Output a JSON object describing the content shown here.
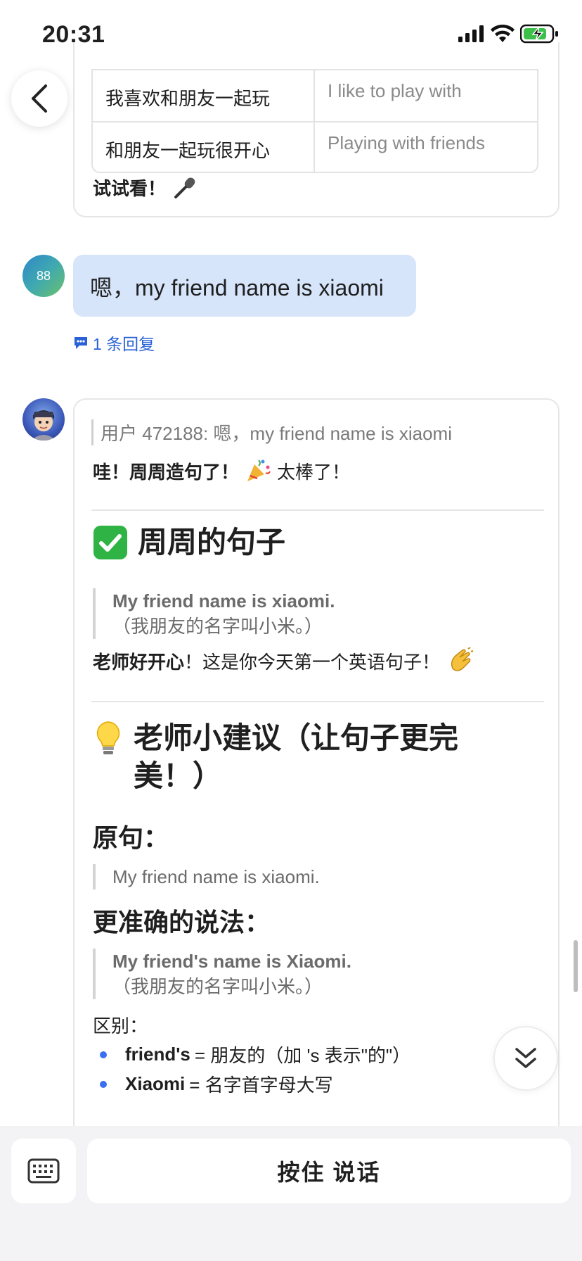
{
  "status_bar": {
    "time": "20:31"
  },
  "top_card": {
    "rows": [
      {
        "cn": "我喜欢和朋友一起玩",
        "en": "I like to play with"
      },
      {
        "cn": "和朋友一起玩很开心",
        "en": "Playing with friends"
      }
    ],
    "try_label": "试试看！"
  },
  "user_message": {
    "avatar_text": "88",
    "text": "嗯，my friend name is xiaomi",
    "reply_count": "1 条回复"
  },
  "bot_message": {
    "quote": "用户 472188: 嗯，my friend name is xiaomi",
    "praise_bold": "哇！周周造句了！",
    "praise_rest": "太棒了！",
    "section1_title": "周周的句子",
    "section1_quote_en": "My friend name is xiaomi.",
    "section1_quote_cn": "（我朋友的名字叫小米。）",
    "section1_para_bold": "老师好开心",
    "section1_para_rest": "！这是你今天第一个英语句子！",
    "section2_title_line1": "老师小建议（让句子更完",
    "section2_title_line2": "美！）",
    "original_label": "原句：",
    "original_sentence": "My friend name is xiaomi.",
    "better_label": "更准确的说法：",
    "better_quote_en": "My friend's name is Xiaomi.",
    "better_quote_cn": "（我朋友的名字叫小米。）",
    "diff_label": "区别：",
    "bullets": [
      {
        "term": "friend's",
        "desc": "= 朋友的（加 's 表示\"的\"）"
      },
      {
        "term": "Xiaomi",
        "desc": "= 名字首字母大写"
      }
    ]
  },
  "input_bar": {
    "hold_to_talk": "按住 说话"
  },
  "icons": {
    "back": "chevron-left-icon",
    "reply": "comment-icon",
    "scroll": "double-chevron-down-icon",
    "keyboard": "keyboard-icon",
    "mic": "microphone-icon",
    "party": "party-popper-icon",
    "check": "check-mark-button-icon",
    "clap": "clapping-hands-icon",
    "bulb": "light-bulb-icon"
  },
  "colors": {
    "user_bubble": "#d7e5fb",
    "link_blue": "#2a62d6",
    "bullet_blue": "#3a6ff0",
    "check_green": "#2fb344",
    "bottom_bar": "#f3f3f5"
  }
}
